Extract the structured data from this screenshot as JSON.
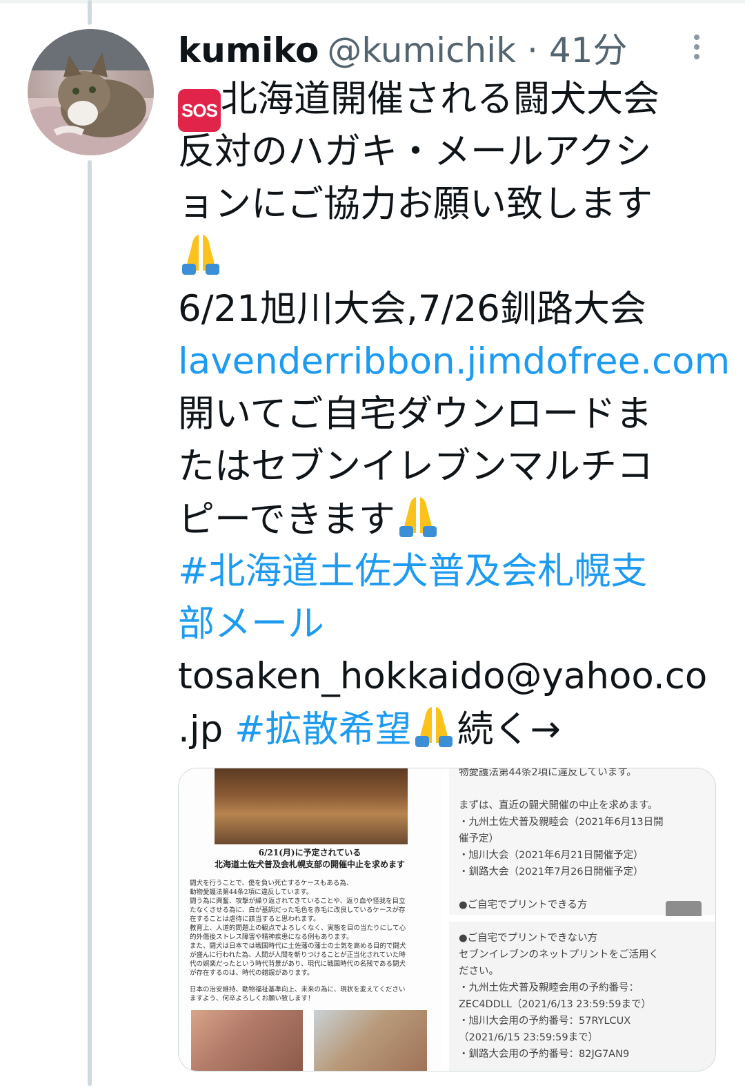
{
  "tweet": {
    "display_name": "kumiko",
    "handle": "@kumichik",
    "separator": "·",
    "time": "41分",
    "lines": {
      "l1": "北海道開催される闘犬大会",
      "l2": "反対のハガキ・メールアクシ",
      "l3": "ョンにご協力お願い致します",
      "l5": "6/21旭川大会,7/26釧路大会",
      "l6_link": "lavenderribbon.jimdofree.com",
      "l7": "開いてご自宅ダウンロードま",
      "l8": "たはセブンイレブンマルチコ",
      "l9": "ピーできます",
      "l10_hash": "#北海道土佐犬普及会札幌支",
      "l11_hash": "部メール",
      "l12": "tosaken_hokkaido@yahoo.co",
      "l13_a": ".jp ",
      "l13_hash": "#拡散希望",
      "l13_b": "続く→"
    },
    "emoji": {
      "sos": "SOS",
      "pray_icon": "folded-hands"
    }
  },
  "media": {
    "left_doc": {
      "title_line1": "6/21(月)に予定されている",
      "title_line2": "北海道土佐犬普及会札幌支部の開催中止を求めます",
      "body": [
        "闘犬を行うことで、傷を負い死亡するケースもある為、",
        "動物愛護法第44条2項に違反しています。",
        "闘う為に興奮、攻撃が繰り返されてきていることや、返り血や怪我を目立",
        "たなくさせる為に、白が基調だった毛色を赤毛に改良しているケースが存",
        "在することは虐待に該当すると思われます。",
        "教育上、人道的問題上の観点でよろしくなく、実態を目の当たりにして心",
        "的外傷後ストレス障害や精神疾患になる例もあります。",
        "また、闘犬は日本では戦国時代に土佐藩の藩士の士気を高める目的で闘犬",
        "が盛んに行われた為、人間が人間を斬りつけることが正当化されていた時",
        "代の娯楽だったという時代背景があり、現代に戦国時代の名残である闘犬",
        "が存在するのは、時代の錯誤があります。"
      ],
      "foot": [
        "日本の治安維持、動物福祉基準向上、未来の為に、現状を変えてください",
        "ますよう、何卒よろしくお願い致します！"
      ]
    },
    "right_top_doc": [
      "物愛護法第44条2項に違反しています。",
      "",
      "まずは、直近の闘犬開催の中止を求めます。",
      "・九州土佐犬普及親睦会（2021年6月13日開",
      "催予定）",
      "・旭川大会（2021年6月21日開催予定）",
      "・釧路大会（2021年7月26日開催予定）",
      "",
      "●ご自宅でプリントできる方"
    ],
    "right_bottom_doc": [
      "●ご自宅でプリントできない方",
      "セブンイレブンのネットプリントをご活用く",
      "ださい。",
      "・九州土佐犬普及親睦会用の予約番号：",
      "ZEC4DDLL（2021/6/13 23:59:59まで）",
      "・旭川大会用の予約番号：57RYLCUX",
      "（2021/6/15 23:59:59まで）",
      "・釧路大会用の予約番号：82JG7AN9"
    ]
  },
  "colors": {
    "link": "#1d9bf0",
    "text": "#0f1419",
    "muted": "#536471",
    "thread_line": "#cfd9de",
    "sos_bg": "#e0244a"
  }
}
